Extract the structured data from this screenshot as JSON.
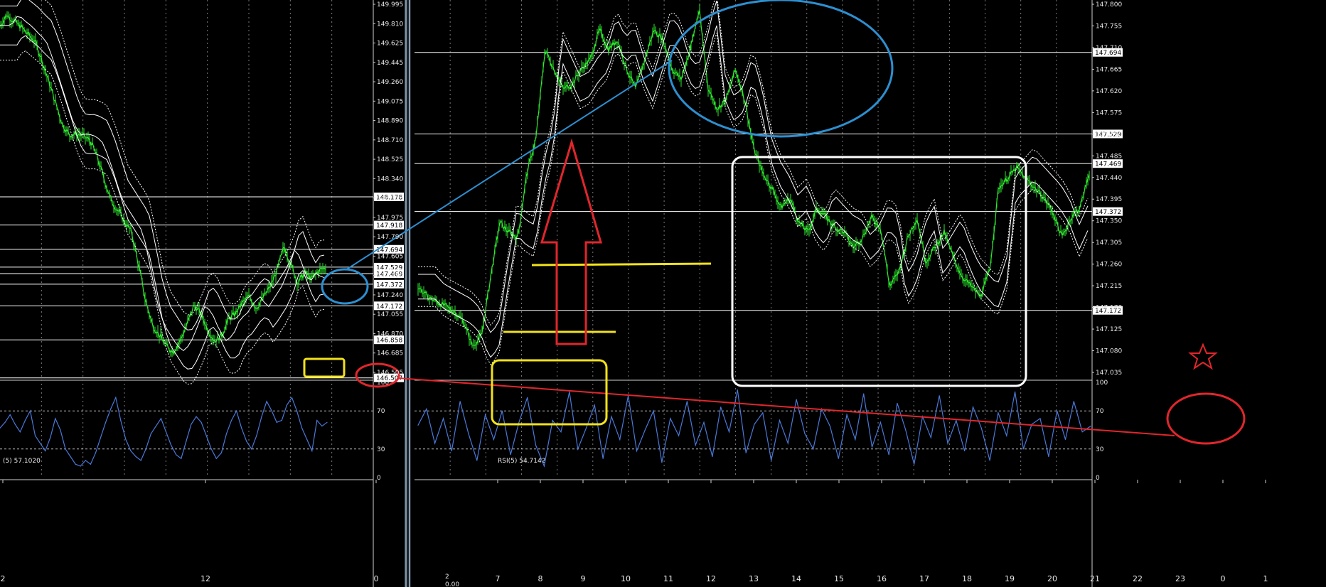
{
  "colors": {
    "background": "#000000",
    "grid": "#7a7a7a",
    "price": "#2ee82e",
    "bands": "#ffffff",
    "rsi": "#4a78d8",
    "panel_divider": "#8a9aa8",
    "annotation_blue": "#2d8fd0",
    "annotation_red": "#e0262c",
    "annotation_yellow": "#f2e21a",
    "annotation_white": "#ffffff"
  },
  "left_panel": {
    "price_axis_labels": [
      "149.995",
      "149.810",
      "149.625",
      "149.445",
      "149.260",
      "149.075",
      "148.890",
      "148.710",
      "148.525",
      "148.340",
      "148.155",
      "147.975",
      "147.790",
      "147.605",
      "147.420",
      "147.240",
      "147.055",
      "146.870",
      "146.685",
      "146.505"
    ],
    "highlight_levels": [
      "148.178",
      "147.918",
      "147.694",
      "147.529",
      "147.469",
      "147.372",
      "147.172",
      "146.858",
      "146.507"
    ],
    "rsi_title": "(5) 57.1020",
    "rsi_axis_labels": [
      "100",
      "70",
      "30",
      "0"
    ],
    "time_labels": [
      "2",
      "12",
      "0"
    ],
    "corner_labels": [
      "2",
      "0.00"
    ]
  },
  "right_panel": {
    "price_axis_labels": [
      "147.800",
      "147.755",
      "147.710",
      "147.665",
      "147.620",
      "147.575",
      "147.530",
      "147.485",
      "147.440",
      "147.395",
      "147.350",
      "147.305",
      "147.260",
      "147.215",
      "147.170",
      "147.125",
      "147.080",
      "147.035"
    ],
    "highlight_levels": [
      "147.694",
      "147.529",
      "147.469",
      "147.372",
      "147.172"
    ],
    "rsi_title": "RSI(5) 54.7142",
    "rsi_axis_labels": [
      "100",
      "70",
      "30",
      "0"
    ],
    "time_labels": [
      "7",
      "8",
      "9",
      "10",
      "11",
      "12",
      "13",
      "14",
      "15",
      "16",
      "17",
      "18",
      "19",
      "20",
      "21",
      "22",
      "23",
      "0",
      "1"
    ]
  },
  "chart_data": [
    {
      "type": "line",
      "panel": "left",
      "series": [
        {
          "values": [
            149.76,
            149.86,
            149.8,
            149.75,
            149.68,
            149.62,
            149.45,
            149.25,
            149.05,
            148.85,
            148.75,
            148.76,
            148.74,
            148.7,
            148.55,
            148.35,
            148.15,
            148.05,
            147.95,
            147.85,
            147.55,
            147.22,
            147.0,
            146.9,
            146.8,
            146.75,
            146.85,
            147.0,
            147.18,
            147.1,
            146.95,
            146.85,
            146.9,
            147.05,
            147.1,
            147.2,
            147.26,
            147.15,
            147.25,
            147.35,
            147.5,
            147.72,
            147.55,
            147.38,
            147.48,
            147.42,
            147.5,
            147.52
          ]
        }
      ],
      "ylim": [
        146.505,
        149.995
      ]
    },
    {
      "type": "line",
      "panel": "right",
      "series": [
        {
          "values": [
            147.22,
            147.2,
            147.19,
            147.18,
            147.17,
            147.15,
            147.1,
            147.12,
            147.24,
            147.35,
            147.33,
            147.32,
            147.45,
            147.52,
            147.7,
            147.66,
            147.62,
            147.63,
            147.66,
            147.68,
            147.74,
            147.7,
            147.72,
            147.66,
            147.62,
            147.68,
            147.74,
            147.72,
            147.66,
            147.64,
            147.7,
            147.78,
            147.62,
            147.58,
            147.6,
            147.66,
            147.6,
            147.5,
            147.45,
            147.42,
            147.38,
            147.4,
            147.35,
            147.33,
            147.38,
            147.36,
            147.34,
            147.33,
            147.3,
            147.32,
            147.36,
            147.34,
            147.22,
            147.25,
            147.32,
            147.36,
            147.27,
            147.3,
            147.33,
            147.28,
            147.24,
            147.22,
            147.2,
            147.25,
            147.42,
            147.44,
            147.46,
            147.44,
            147.42,
            147.4,
            147.37,
            147.32,
            147.36,
            147.38,
            147.45
          ]
        }
      ],
      "ylim": [
        147.035,
        147.8
      ]
    },
    {
      "type": "line",
      "panel": "left",
      "title": "(5) 57.1020",
      "series": [
        {
          "values": [
            52,
            58,
            66,
            56,
            48,
            60,
            70,
            44,
            36,
            28,
            42,
            62,
            50,
            30,
            22,
            14,
            12,
            18,
            14,
            26,
            42,
            58,
            72,
            84,
            60,
            40,
            28,
            22,
            18,
            30,
            46,
            54,
            62,
            48,
            34,
            24,
            20,
            38,
            56,
            64,
            58,
            44,
            30,
            20,
            26,
            46,
            60,
            70,
            52,
            38,
            30,
            44,
            64,
            80,
            70,
            58,
            60,
            76,
            84,
            70,
            52,
            40,
            28,
            60,
            54,
            58
          ]
        }
      ],
      "ylim": [
        0,
        100
      ]
    },
    {
      "type": "line",
      "panel": "right",
      "title": "RSI(5) 54.7142",
      "series": [
        {
          "values": [
            55,
            72,
            36,
            62,
            28,
            80,
            46,
            18,
            66,
            40,
            70,
            24,
            58,
            84,
            34,
            12,
            60,
            48,
            90,
            30,
            52,
            76,
            20,
            64,
            40,
            86,
            28,
            50,
            70,
            16,
            62,
            44,
            80,
            34,
            58,
            22,
            74,
            48,
            92,
            26,
            56,
            68,
            18,
            60,
            36,
            82,
            46,
            30,
            72,
            54,
            20,
            66,
            40,
            88,
            32,
            58,
            24,
            78,
            50,
            14,
            64,
            42,
            86,
            36,
            60,
            28,
            74,
            52,
            18,
            68,
            44,
            90,
            30,
            56,
            62,
            22,
            70,
            40,
            80,
            48,
            54
          ]
        }
      ],
      "ylim": [
        0,
        100
      ]
    }
  ]
}
